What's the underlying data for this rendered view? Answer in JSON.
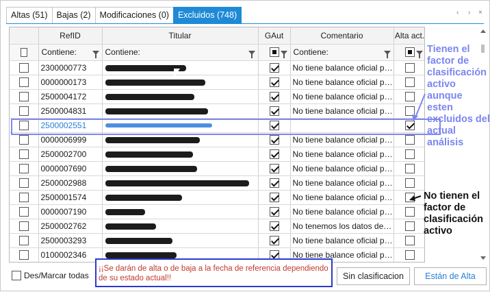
{
  "tabs": [
    {
      "label": "Altas (51)",
      "active": false
    },
    {
      "label": "Bajas (2)",
      "active": false
    },
    {
      "label": "Modificaciones (0)",
      "active": false
    },
    {
      "label": "Excluidos (748)",
      "active": true
    }
  ],
  "tab_nav": {
    "prev": "‹",
    "next": "›",
    "close": "×"
  },
  "columns": {
    "refid": "RefID",
    "titular": "Titular",
    "gaut": "GAut",
    "comentario": "Comentario",
    "alta": "Alta act."
  },
  "filters": {
    "refid": "Contiene:",
    "titular": "Contiene:",
    "comentario": "Contiene:"
  },
  "rows": [
    {
      "ref": "2300000773",
      "gaut": true,
      "com": "No tiene balance oficial po...",
      "alta": false
    },
    {
      "ref": "0000000173",
      "gaut": true,
      "com": "No tiene balance oficial po...",
      "alta": false
    },
    {
      "ref": "2500004172",
      "gaut": true,
      "com": "No tiene balance oficial po...",
      "alta": false
    },
    {
      "ref": "2500004831",
      "gaut": true,
      "com": "No tiene balance oficial po...",
      "alta": false
    },
    {
      "ref": "2500002551",
      "gaut": true,
      "com": "",
      "alta": true,
      "selected": true
    },
    {
      "ref": "0000006999",
      "gaut": true,
      "com": "No tiene balance oficial po...",
      "alta": false
    },
    {
      "ref": "2500002700",
      "gaut": true,
      "com": "No tiene balance oficial po...",
      "alta": false
    },
    {
      "ref": "0000007690",
      "gaut": true,
      "com": "No tiene balance oficial po...",
      "alta": false
    },
    {
      "ref": "2500002988",
      "gaut": true,
      "com": "No tiene balance oficial po...",
      "alta": false
    },
    {
      "ref": "2500001574",
      "gaut": true,
      "com": "No tiene balance oficial po...",
      "alta": false
    },
    {
      "ref": "0000007190",
      "gaut": true,
      "com": "No tiene balance oficial po...",
      "alta": false
    },
    {
      "ref": "2500002762",
      "gaut": true,
      "com": "No tenemos los datos del s...",
      "alta": false
    },
    {
      "ref": "2500003293",
      "gaut": true,
      "com": "No tiene balance oficial po...",
      "alta": false
    },
    {
      "ref": "0100002346",
      "gaut": true,
      "com": "No tiene balance oficial po...",
      "alta": false
    }
  ],
  "bottom": {
    "desmarcar": "Des/Marcar todas",
    "warning": "¡¡Se darán de alta o de baja a la fecha de referencia dependiendo de su estado actual!!",
    "sin_clasificacion": "Sin clasificacion",
    "estan_de_alta": "Están de Alta"
  },
  "annotations": {
    "note1": "Tienen el factor de clasificación activo aunque esten excluidos del actual análisis",
    "note2": "No tienen el factor de clasificación activo"
  },
  "colors": {
    "accent": "#1e8ad6",
    "annotation_blue": "#7b86ef",
    "warning_red": "#c0392b",
    "highlight_box": "#2c39d0"
  }
}
